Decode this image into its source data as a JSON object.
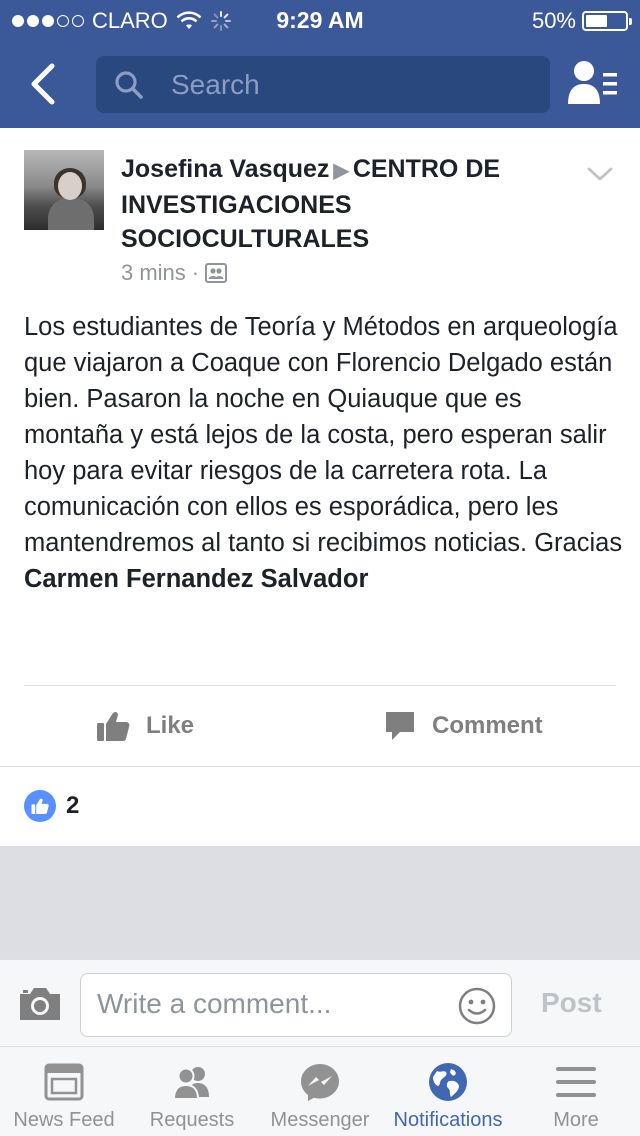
{
  "status_bar": {
    "carrier": "CLARO",
    "time": "9:29 AM",
    "battery": "50%",
    "battery_level": 0.5
  },
  "header": {
    "search_placeholder": "Search",
    "back_icon": "back-arrow-icon",
    "friends_icon": "friend-requests-icon"
  },
  "post": {
    "author": "Josefina Vasquez",
    "target": "CENTRO DE INVESTIGACIONES SOCIOCULTURALES",
    "time": "3 mins",
    "separator": "·",
    "audience_icon": "group-audience-icon",
    "text": "Los estudiantes de Teoría y Métodos en arqueología que viajaron a Coaque con Florencio Delgado están bien. Pasaron la noche en Quiauque que es montaña y está lejos de la costa, pero esperan salir hoy para evitar riesgos de la carretera rota. La comunicación con ellos es esporádica, pero les mantendremos al tanto si recibimos noticias. Gracias ",
    "mention": "Carmen Fernandez Salvador",
    "like_label": "Like",
    "comment_label": "Comment",
    "like_count": "2"
  },
  "comment_bar": {
    "placeholder": "Write a comment...",
    "post_label": "Post"
  },
  "tabs": [
    {
      "label": "News Feed",
      "icon": "news-feed-icon",
      "active": false
    },
    {
      "label": "Requests",
      "icon": "requests-icon",
      "active": false
    },
    {
      "label": "Messenger",
      "icon": "messenger-icon",
      "active": false
    },
    {
      "label": "Notifications",
      "icon": "globe-icon",
      "active": true
    },
    {
      "label": "More",
      "icon": "menu-icon",
      "active": false
    }
  ],
  "colors": {
    "brand": "#3b5998",
    "active_tab": "#4267b2",
    "like_badge": "#5890ff"
  }
}
